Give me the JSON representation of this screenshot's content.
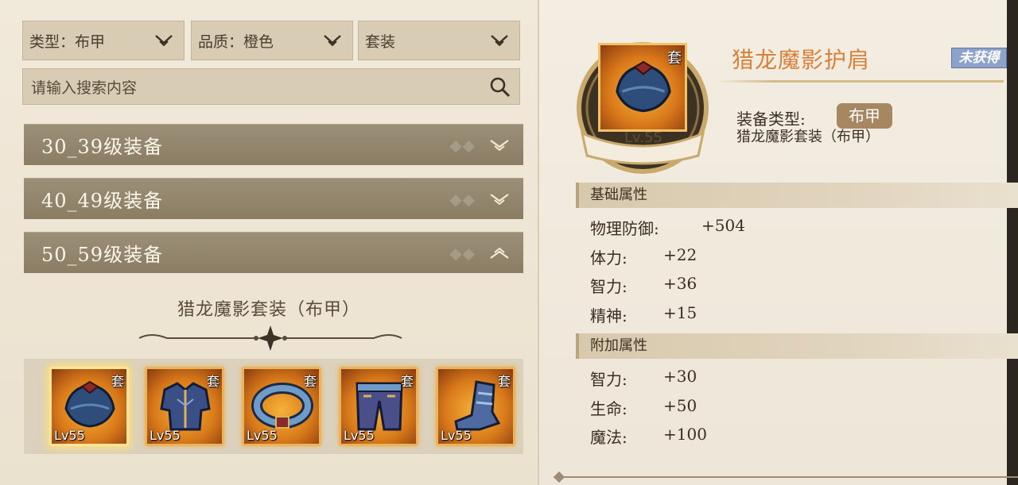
{
  "filters": {
    "type": "类型：布甲",
    "quality": "品质：橙色",
    "set": "套装"
  },
  "search": {
    "placeholder": "请输入搜索内容"
  },
  "level_groups": [
    {
      "label": "30_39级装备",
      "expanded": false
    },
    {
      "label": "40_49级装备",
      "expanded": false
    },
    {
      "label": "50_59级装备",
      "expanded": true
    }
  ],
  "set_title": "猎龙魔影套装（布甲）",
  "items": [
    {
      "icon": "shoulder-armor-icon",
      "level": "Lv55",
      "set_tag": "套",
      "selected": true
    },
    {
      "icon": "chest-armor-icon",
      "level": "Lv55",
      "set_tag": "套",
      "selected": false
    },
    {
      "icon": "belt-icon",
      "level": "Lv55",
      "set_tag": "套",
      "selected": false
    },
    {
      "icon": "leg-armor-icon",
      "level": "Lv55",
      "set_tag": "套",
      "selected": false
    },
    {
      "icon": "boots-icon",
      "level": "Lv55",
      "set_tag": "套",
      "selected": false
    }
  ],
  "detail": {
    "set_tag": "套",
    "level": "Lv.55",
    "name": "猎龙魔影护肩",
    "status": "未获得",
    "equip_type_label": "装备类型:",
    "equip_type": "布甲",
    "set_name": "猎龙魔影套装（布甲）",
    "base_title": "基础属性",
    "base_stats": [
      {
        "label": "物理防御:",
        "value": "+504"
      },
      {
        "label": "体力:",
        "value": "+22"
      },
      {
        "label": "智力:",
        "value": "+36"
      },
      {
        "label": "精神:",
        "value": "+15"
      }
    ],
    "extra_title": "附加属性",
    "extra_stats": [
      {
        "label": "智力:",
        "value": "+30"
      },
      {
        "label": "生命:",
        "value": "+50"
      },
      {
        "label": "魔法:",
        "value": "+100"
      }
    ]
  },
  "colors": {
    "accent_name": "#d9803a",
    "status_badge": "#8ea2c9",
    "level_bar": "#8a7d64"
  }
}
